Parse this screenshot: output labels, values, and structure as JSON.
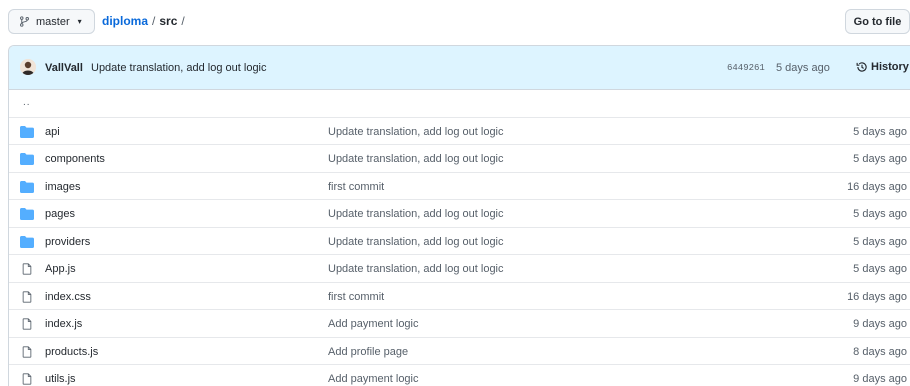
{
  "header": {
    "branch": "master",
    "repo": "diploma",
    "separator": "/",
    "dir": "src",
    "trailing_sep": "/",
    "goto_file": "Go to file"
  },
  "latest_commit": {
    "author": "VallVall",
    "message": "Update translation, add log out logic",
    "sha": "6449261",
    "age": "5 days ago",
    "history_label": "History"
  },
  "parent_link": "..",
  "files": [
    {
      "type": "folder",
      "name": "api",
      "message": "Update translation, add log out logic",
      "age": "5 days ago"
    },
    {
      "type": "folder",
      "name": "components",
      "message": "Update translation, add log out logic",
      "age": "5 days ago"
    },
    {
      "type": "folder",
      "name": "images",
      "message": "first commit",
      "age": "16 days ago"
    },
    {
      "type": "folder",
      "name": "pages",
      "message": "Update translation, add log out logic",
      "age": "5 days ago"
    },
    {
      "type": "folder",
      "name": "providers",
      "message": "Update translation, add log out logic",
      "age": "5 days ago"
    },
    {
      "type": "file",
      "name": "App.js",
      "message": "Update translation, add log out logic",
      "age": "5 days ago"
    },
    {
      "type": "file",
      "name": "index.css",
      "message": "first commit",
      "age": "16 days ago"
    },
    {
      "type": "file",
      "name": "index.js",
      "message": "Add payment logic",
      "age": "9 days ago"
    },
    {
      "type": "file",
      "name": "products.js",
      "message": "Add profile page",
      "age": "8 days ago"
    },
    {
      "type": "file",
      "name": "utils.js",
      "message": "Add payment logic",
      "age": "9 days ago"
    }
  ],
  "colors": {
    "link": "#0969da",
    "folder": "#54aeff",
    "commit_bar_bg": "#ddf4ff",
    "muted": "#57606a"
  }
}
